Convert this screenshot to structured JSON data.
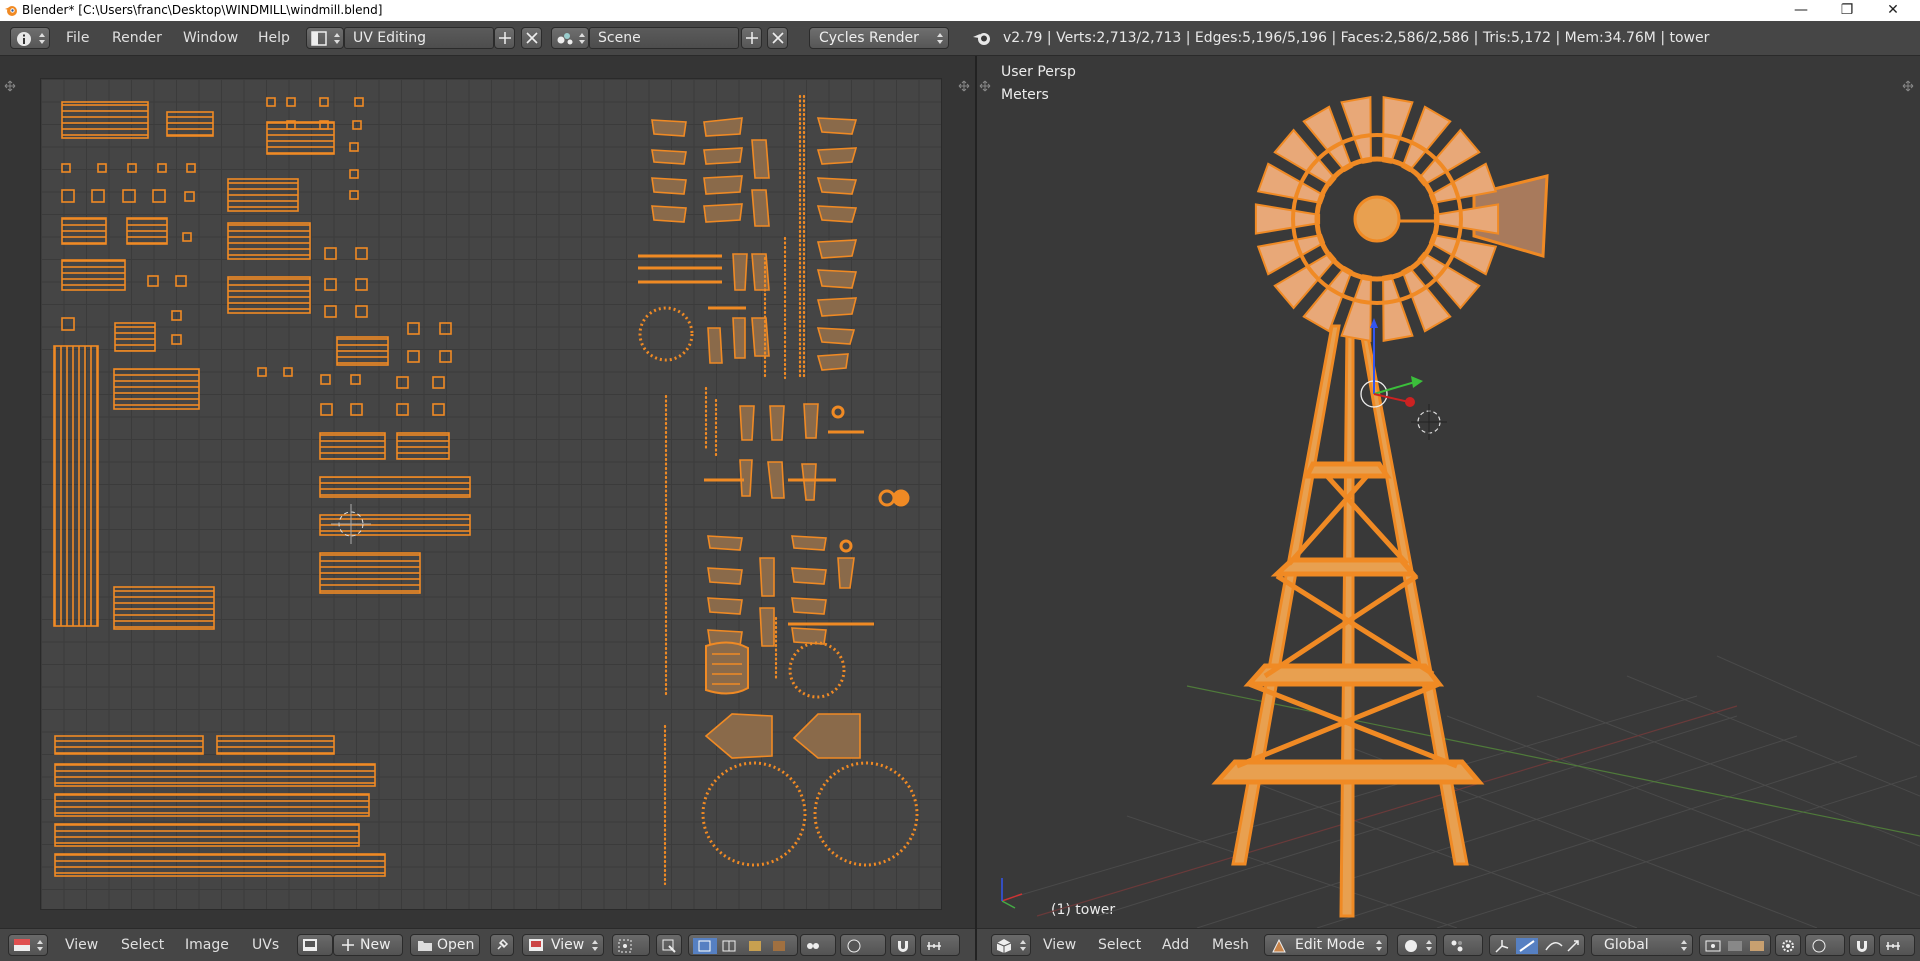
{
  "window": {
    "title": "Blender* [C:\\Users\\franc\\Desktop\\WINDMILL\\windmill.blend]",
    "minimize": "—",
    "maximize": "❐",
    "close": "✕"
  },
  "topbar": {
    "menus": [
      "File",
      "Render",
      "Window",
      "Help"
    ],
    "screen_layout": "UV Editing",
    "scene": "Scene",
    "render_engine": "Cycles Render",
    "stats": "v2.79 | Verts:2,713/2,713 | Edges:5,196/5,196 | Faces:2,586/2,586 | Tris:5,172 | Mem:34.76M | tower"
  },
  "viewport": {
    "view_label": "User Persp",
    "units_label": "Meters",
    "object_label": "(1) tower"
  },
  "uv_header": {
    "menus": [
      "View",
      "Select",
      "Image",
      "UVs"
    ],
    "new_label": "New",
    "open_label": "Open",
    "view_dropdown": "View"
  },
  "view3d_header": {
    "menus": [
      "View",
      "Select",
      "Add",
      "Mesh"
    ],
    "mode": "Edit Mode",
    "orientation": "Global"
  },
  "colors": {
    "accent": "#f0851c",
    "uv_fill": "#8a6a4a",
    "background": "#3d3d3d",
    "grid": "#454545",
    "tower": "#e89a3c"
  }
}
